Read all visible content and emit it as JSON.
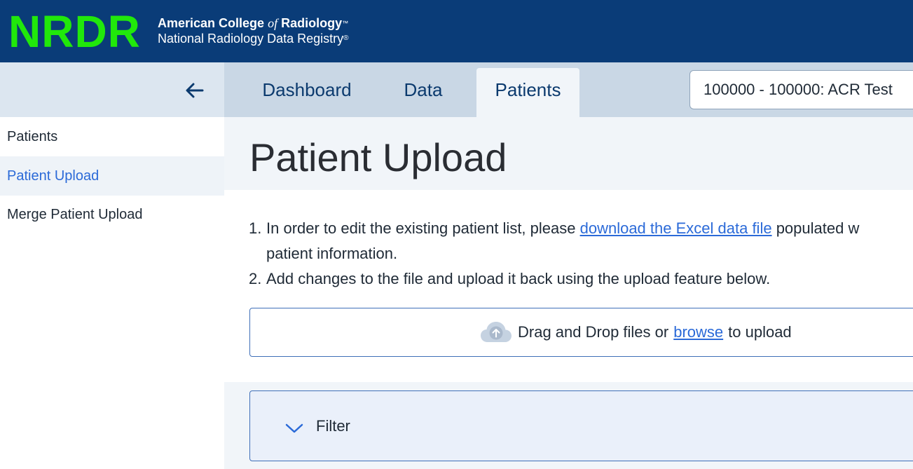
{
  "header": {
    "logo": "NRDR",
    "org_line1_a": "American College ",
    "org_line1_of": "of",
    "org_line1_b": " Radiology",
    "org_line1_tm": "™",
    "org_line2": "National Radiology Data Registry",
    "org_line2_reg": "®"
  },
  "sidebar": {
    "back_icon": "arrow-left-icon",
    "items": [
      {
        "label": "Patients"
      },
      {
        "label": "Patient Upload",
        "active": true
      },
      {
        "label": "Merge Patient Upload"
      }
    ]
  },
  "tabs": [
    {
      "label": "Dashboard"
    },
    {
      "label": "Data"
    },
    {
      "label": "Patients",
      "active": true
    }
  ],
  "site_select": {
    "value": "100000 - 100000: ACR Test"
  },
  "page": {
    "title": "Patient Upload"
  },
  "instructions": {
    "item1_num": "1.",
    "item1_pre": "In order to edit the existing patient list, please ",
    "item1_link": "download the Excel data file",
    "item1_post": " populated w",
    "item1_cont": "patient information.",
    "item2_num": "2.",
    "item2_text": "Add changes to the file and upload it back using the upload feature below."
  },
  "upload": {
    "icon": "cloud-upload-icon",
    "text_pre": "Drag and Drop files or",
    "link": "browse",
    "text_post": "to upload"
  },
  "filter": {
    "icon": "chevron-down-icon",
    "label": "Filter"
  },
  "colors": {
    "header_bg": "#0a3c78",
    "logo_green": "#21e80b",
    "link_blue": "#2b6ad8",
    "tab_bar_bg": "#c9d7e5",
    "panel_bg": "#f1f5f9"
  }
}
